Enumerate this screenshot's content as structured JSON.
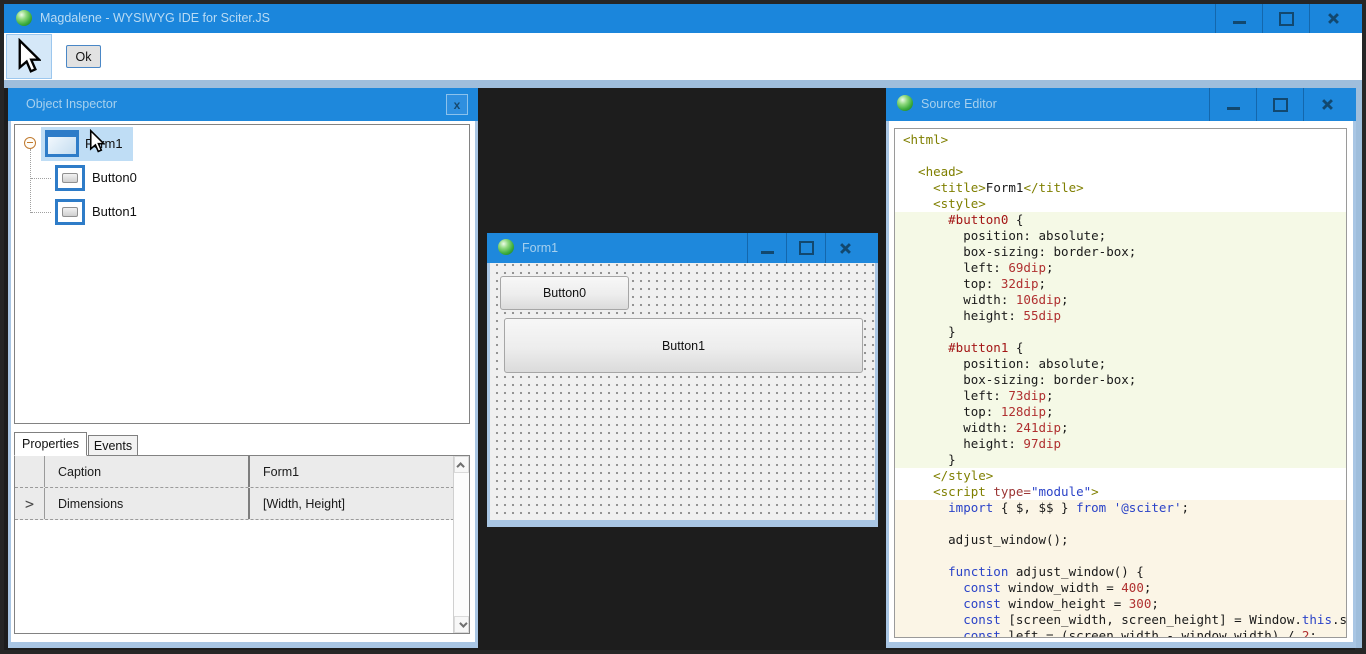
{
  "window": {
    "title": "Magdalene - WYSIWYG IDE for Sciter.JS"
  },
  "toolbar": {
    "ok": "Ok",
    "pointer_tool": "pointer-tool"
  },
  "colors": {
    "titlebar_blue": "#1E88DC",
    "panel_frame_blue": "#A9C6E4",
    "dock_background": "#1D1D1D",
    "selection_highlight": "#BFDDF5",
    "css_block_bg": "#F5F9E6",
    "js_block_bg": "#FBF5E6",
    "syntax_tag": "#7F7F00",
    "syntax_selector": "#A31515",
    "syntax_number": "#B03030",
    "syntax_keyword": "#2B43C8"
  },
  "inspector": {
    "title": "Object Inspector",
    "close": "x",
    "tree": [
      {
        "label": "Form1",
        "icon": "form",
        "selected": true
      },
      {
        "label": "Button0",
        "icon": "button",
        "selected": false
      },
      {
        "label": "Button1",
        "icon": "button",
        "selected": false
      }
    ],
    "tabs": [
      "Properties",
      "Events"
    ],
    "active_tab": "Properties",
    "rows": [
      {
        "name": "Caption",
        "value": "Form1",
        "expander": ""
      },
      {
        "name": "Dimensions",
        "value": "[Width, Height]",
        "expander": ">"
      }
    ]
  },
  "designer": {
    "title": "Form1",
    "buttons": [
      {
        "label": "Button0"
      },
      {
        "label": "Button1"
      }
    ]
  },
  "editor": {
    "title": "Source Editor",
    "lines": [
      {
        "bg": "w",
        "seg": [
          [
            "tag",
            "<html>"
          ]
        ]
      },
      {
        "bg": "w",
        "seg": []
      },
      {
        "bg": "w",
        "seg": [
          [
            "tag",
            "  <head>"
          ]
        ]
      },
      {
        "bg": "w",
        "seg": [
          [
            "tag",
            "    <title>"
          ],
          [
            "plain",
            "Form1"
          ],
          [
            "tag",
            "</title>"
          ]
        ]
      },
      {
        "bg": "w",
        "seg": [
          [
            "tag",
            "    <style>"
          ]
        ]
      },
      {
        "bg": "css",
        "seg": [
          [
            "sel",
            "      #button0"
          ],
          [
            "plain",
            " {"
          ]
        ]
      },
      {
        "bg": "css",
        "seg": [
          [
            "plain",
            "        position: absolute;"
          ]
        ]
      },
      {
        "bg": "css",
        "seg": [
          [
            "plain",
            "        box-sizing: border-box;"
          ]
        ]
      },
      {
        "bg": "css",
        "seg": [
          [
            "plain",
            "        left: "
          ],
          [
            "num",
            "69dip"
          ],
          [
            "plain",
            ";"
          ]
        ]
      },
      {
        "bg": "css",
        "seg": [
          [
            "plain",
            "        top: "
          ],
          [
            "num",
            "32dip"
          ],
          [
            "plain",
            ";"
          ]
        ]
      },
      {
        "bg": "css",
        "seg": [
          [
            "plain",
            "        width: "
          ],
          [
            "num",
            "106dip"
          ],
          [
            "plain",
            ";"
          ]
        ]
      },
      {
        "bg": "css",
        "seg": [
          [
            "plain",
            "        height: "
          ],
          [
            "num",
            "55dip"
          ]
        ]
      },
      {
        "bg": "css",
        "seg": [
          [
            "plain",
            "      }"
          ]
        ]
      },
      {
        "bg": "css",
        "seg": [
          [
            "sel",
            "      #button1"
          ],
          [
            "plain",
            " {"
          ]
        ]
      },
      {
        "bg": "css",
        "seg": [
          [
            "plain",
            "        position: absolute;"
          ]
        ]
      },
      {
        "bg": "css",
        "seg": [
          [
            "plain",
            "        box-sizing: border-box;"
          ]
        ]
      },
      {
        "bg": "css",
        "seg": [
          [
            "plain",
            "        left: "
          ],
          [
            "num",
            "73dip"
          ],
          [
            "plain",
            ";"
          ]
        ]
      },
      {
        "bg": "css",
        "seg": [
          [
            "plain",
            "        top: "
          ],
          [
            "num",
            "128dip"
          ],
          [
            "plain",
            ";"
          ]
        ]
      },
      {
        "bg": "css",
        "seg": [
          [
            "plain",
            "        width: "
          ],
          [
            "num",
            "241dip"
          ],
          [
            "plain",
            ";"
          ]
        ]
      },
      {
        "bg": "css",
        "seg": [
          [
            "plain",
            "        height: "
          ],
          [
            "num",
            "97dip"
          ]
        ]
      },
      {
        "bg": "css",
        "seg": [
          [
            "plain",
            "      }"
          ]
        ]
      },
      {
        "bg": "w",
        "seg": [
          [
            "tag",
            "    </style>"
          ]
        ]
      },
      {
        "bg": "w",
        "seg": [
          [
            "tag",
            "    <script "
          ],
          [
            "attr",
            "type="
          ],
          [
            "str",
            "\"module\""
          ],
          [
            "tag",
            ">"
          ]
        ]
      },
      {
        "bg": "js",
        "seg": [
          [
            "kw",
            "      import"
          ],
          [
            "plain",
            " { $, $$ } "
          ],
          [
            "kw",
            "from"
          ],
          [
            "plain",
            " "
          ],
          [
            "str",
            "'@sciter'"
          ],
          [
            "plain",
            ";"
          ]
        ]
      },
      {
        "bg": "js",
        "seg": []
      },
      {
        "bg": "js",
        "seg": [
          [
            "plain",
            "      adjust_window();"
          ]
        ]
      },
      {
        "bg": "js",
        "seg": []
      },
      {
        "bg": "js",
        "seg": [
          [
            "kw",
            "      function"
          ],
          [
            "plain",
            " adjust_window() {"
          ]
        ]
      },
      {
        "bg": "js",
        "seg": [
          [
            "kw",
            "        const"
          ],
          [
            "plain",
            " window_width = "
          ],
          [
            "num",
            "400"
          ],
          [
            "plain",
            ";"
          ]
        ]
      },
      {
        "bg": "js",
        "seg": [
          [
            "kw",
            "        const"
          ],
          [
            "plain",
            " window_height = "
          ],
          [
            "num",
            "300"
          ],
          [
            "plain",
            ";"
          ]
        ]
      },
      {
        "bg": "js",
        "seg": [
          [
            "kw",
            "        const"
          ],
          [
            "plain",
            " [screen_width, screen_height] = Window."
          ],
          [
            "kw",
            "this"
          ],
          [
            "plain",
            ".screen"
          ]
        ]
      },
      {
        "bg": "js",
        "seg": [
          [
            "kw",
            "        const"
          ],
          [
            "plain",
            " left = (screen_width - window_width) / "
          ],
          [
            "num",
            "2"
          ],
          [
            "plain",
            ";"
          ]
        ]
      }
    ]
  }
}
